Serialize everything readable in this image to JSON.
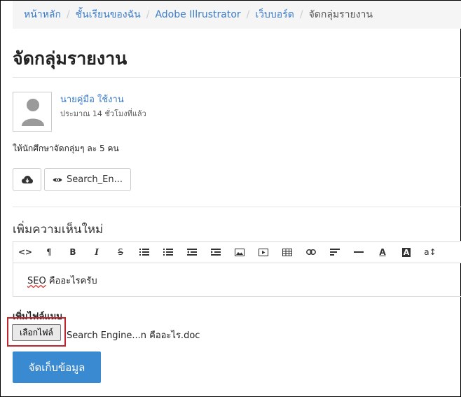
{
  "breadcrumb": {
    "items": [
      "หน้าหลัก",
      "ชั้นเรียนของฉัน",
      "Adobe Illrustrator",
      "เว็บบอร์ด"
    ],
    "current": "จัดกลุ่มรายงาน"
  },
  "page_title": "จัดกลุ่มรายงาน",
  "post": {
    "author": "นายคู่มือ ใช้งาน",
    "time": "ประมาณ 14 ชั่วโมงที่แล้ว",
    "text": "ให้นักศึกษาจัดกลุ่มๆ ละ 5 คน",
    "attachment_label": "Search_En..."
  },
  "comment": {
    "heading": "เพิ่มความเห็นใหม่",
    "editor_text_prefix": "SEO",
    "editor_text_rest": " คืออะไรครับ",
    "attach_label": "เพิ่มไฟล์แนบ",
    "choose_button": "เลือกไฟล์",
    "file_name": "Search Engine...n คืออะไร.doc",
    "submit": "จัดเก็บข้อมูล"
  },
  "toolbar": [
    "code-view",
    "paragraph",
    "bold",
    "italic",
    "strikethrough",
    "bullet-list",
    "numbered-list",
    "outdent",
    "indent",
    "image",
    "video",
    "table",
    "link",
    "align",
    "horizontal-rule",
    "text-color",
    "background-color",
    "font-size"
  ],
  "colors": {
    "link": "#3a7bc8",
    "primary": "#3a8ad1",
    "highlight_box": "#c0262d"
  }
}
